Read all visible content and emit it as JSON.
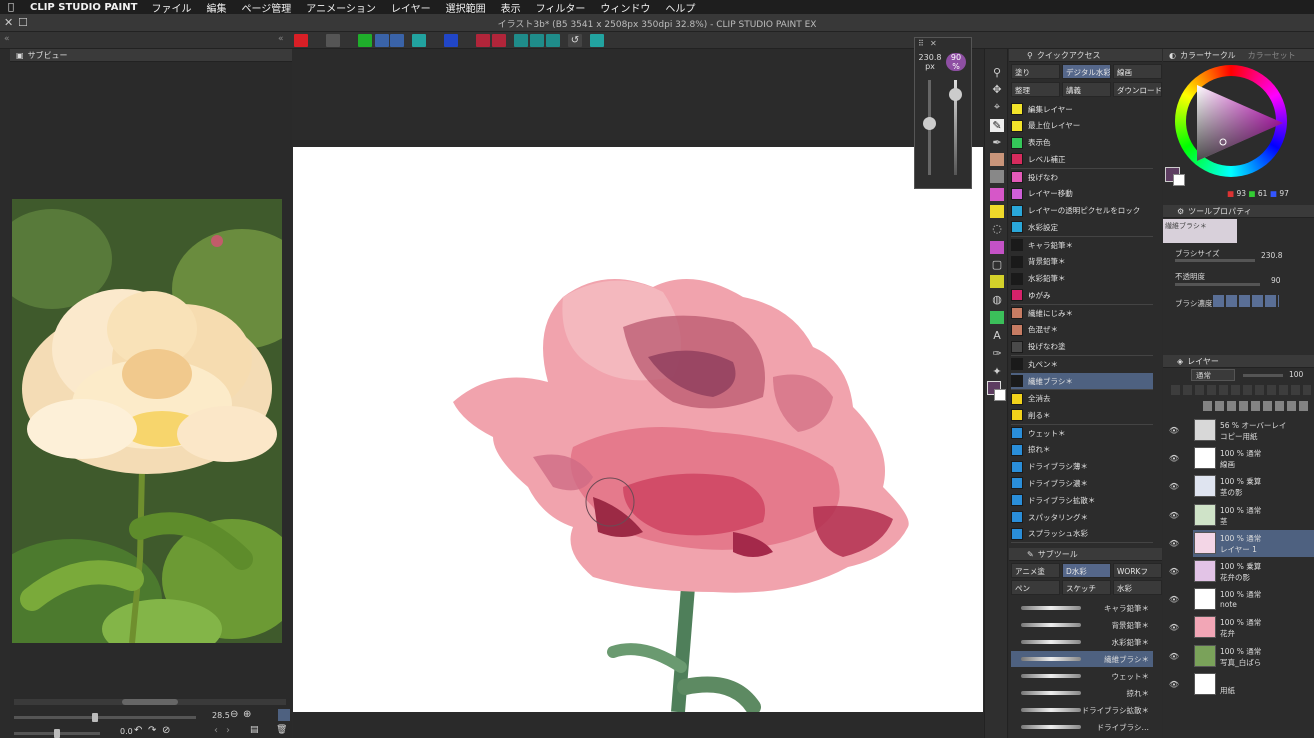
{
  "app": {
    "apple_icon": "apple-icon",
    "name": "CLIP STUDIO PAINT",
    "menu": [
      "ファイル",
      "編集",
      "ページ管理",
      "アニメーション",
      "レイヤー",
      "選択範囲",
      "表示",
      "フィルター",
      "ウィンドウ",
      "ヘルプ"
    ]
  },
  "window": {
    "title": "イラスト3b* (B5 3541 x 2508px 350dpi 32.8%)  - CLIP STUDIO PAINT EX",
    "close_glyph": "✕",
    "maximize_glyph": "☐"
  },
  "subview": {
    "title": "サブビュー",
    "zoom": "28.5",
    "angle": "0.0"
  },
  "brush_popup": {
    "size_value": "230.8",
    "size_unit": "px",
    "opacity_value": "90",
    "opacity_unit": "%",
    "size_level": 0.55,
    "opacity_level": 0.9
  },
  "quick_access": {
    "title": "クイックアクセス",
    "tabs": [
      "塗り",
      "デジタル水彩",
      "線画",
      "整理",
      "講義",
      "ダウンロード"
    ],
    "selected_tab": "デジタル水彩",
    "groups": [
      [
        {
          "label": "編集レイヤー",
          "color": "#f2e32a"
        },
        {
          "label": "最上位レイヤー",
          "color": "#f2e32a"
        },
        {
          "label": "表示色",
          "color": "#34c759"
        },
        {
          "label": "レベル補正",
          "color": "#d62b5d"
        }
      ],
      [
        {
          "label": "投げなわ",
          "color": "#e35ab8"
        },
        {
          "label": "レイヤー移動",
          "color": "#cf5fd8"
        },
        {
          "label": "レイヤーの透明ピクセルをロック",
          "color": "#2aa7d9"
        },
        {
          "label": "水彩設定",
          "color": "#2aa7d9"
        }
      ],
      [
        {
          "label": "キャラ鉛筆＊",
          "color": "#1a1a1a"
        },
        {
          "label": "背景鉛筆＊",
          "color": "#1a1a1a"
        },
        {
          "label": "水彩鉛筆＊",
          "color": "#1a1a1a"
        },
        {
          "label": "ゆがみ",
          "color": "#d6226a"
        }
      ],
      [
        {
          "label": "繊維にじみ＊",
          "color": "#c77c63"
        },
        {
          "label": "色混ぜ＊",
          "color": "#c77c63"
        },
        {
          "label": "投げなわ塗",
          "color": "#4a4a4a"
        }
      ],
      [
        {
          "label": "丸ペン＊",
          "color": "#1a1a1a"
        },
        {
          "label": "繊維ブラシ＊",
          "color": "#1a1a1a",
          "selected": true
        }
      ],
      [
        {
          "label": "全消去",
          "color": "#f2d21b"
        },
        {
          "label": "削る＊",
          "color": "#f2d21b"
        }
      ],
      [
        {
          "label": "ウェット＊",
          "color": "#2a8ed9"
        },
        {
          "label": "掠れ＊",
          "color": "#2a8ed9"
        },
        {
          "label": "ドライブラシ薄＊",
          "color": "#2a8ed9"
        },
        {
          "label": "ドライブラシ濃＊",
          "color": "#2a8ed9"
        },
        {
          "label": "ドライブラシ拡散＊",
          "color": "#2a8ed9"
        },
        {
          "label": "スパッタリング＊",
          "color": "#2a8ed9"
        },
        {
          "label": "スプラッシュ水彩",
          "color": "#2a8ed9"
        }
      ]
    ]
  },
  "subtool": {
    "title": "サブツール",
    "tabs_row1": [
      "アニメ塗",
      "D水彩",
      "WORKフ"
    ],
    "tabs_row2": [
      "ペン",
      "スケッチ",
      "水彩"
    ],
    "selected_tab": "D水彩",
    "brushes": [
      "キャラ鉛筆＊",
      "背景鉛筆＊",
      "水彩鉛筆＊",
      "繊維ブラシ＊",
      "ウェット＊",
      "掠れ＊",
      "ドライブラシ拡散＊",
      "ドライブラシ…"
    ],
    "selected_brush": "繊維ブラシ＊"
  },
  "color_circle": {
    "title": "カラーサークル",
    "tab2": "カラーセット",
    "r": "93",
    "g": "61",
    "b": "97",
    "main_color": "#5d3d61"
  },
  "tool_property": {
    "title": "ツールプロパティ",
    "brush_name": "繊維ブラシ＊",
    "brush_size_label": "ブラシサイズ",
    "brush_size_value": "230.8",
    "opacity_label": "不透明度",
    "opacity_value": "90",
    "density_label": "ブラシ濃度"
  },
  "layers_panel": {
    "title": "レイヤー",
    "blend_mode": "通常",
    "opacity": "100",
    "layers": [
      {
        "mode": "56 % オーバーレイ",
        "name": "コピー用紙",
        "thumb": "#d8d8d8"
      },
      {
        "mode": "100 % 通常",
        "name": "線画",
        "thumb": "#ffffff"
      },
      {
        "mode": "100 % 乗算",
        "name": "茎の影",
        "thumb": "#dfe4f0"
      },
      {
        "mode": "100 % 通常",
        "name": "茎",
        "thumb": "#cfe3c8"
      },
      {
        "mode": "100 % 通常",
        "name": "レイヤー 1",
        "thumb": "#f3d6e6",
        "selected": true
      },
      {
        "mode": "100 % 乗算",
        "name": "花弁の影",
        "thumb": "#e2c3e6"
      },
      {
        "mode": "100 % 通常",
        "name": "note",
        "thumb": "#ffffff"
      },
      {
        "mode": "100 % 通常",
        "name": "花弁",
        "thumb": "#f2a6b6"
      },
      {
        "mode": "100 % 通常",
        "name": "写真_白ばら",
        "thumb": "#7aa25a"
      },
      {
        "mode": "",
        "name": "用紙",
        "thumb": "#ffffff"
      }
    ]
  }
}
